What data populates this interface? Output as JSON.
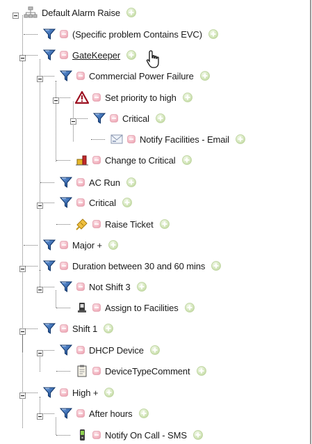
{
  "tree": {
    "root": {
      "label": "Default Alarm Raise",
      "icon": "org-chart-icon"
    },
    "nodes": [
      {
        "label": "(Specific problem Contains EVC)",
        "icon": "filter-icon"
      },
      {
        "label": "GateKeeper",
        "icon": "filter-icon"
      },
      {
        "label": "Commercial Power Failure",
        "icon": "filter-icon"
      },
      {
        "label": "Set priority to high",
        "icon": "warning-icon"
      },
      {
        "label": "Critical",
        "icon": "filter-icon"
      },
      {
        "label": "Notify Facilities - Email",
        "icon": "email-icon"
      },
      {
        "label": "Change to Critical",
        "icon": "severity-change-icon"
      },
      {
        "label": "AC Run",
        "icon": "filter-icon"
      },
      {
        "label": "Critical",
        "icon": "filter-icon"
      },
      {
        "label": "Raise Ticket",
        "icon": "ticket-icon"
      },
      {
        "label": "Major +",
        "icon": "filter-icon"
      },
      {
        "label": "Duration between 30 and 60 mins",
        "icon": "filter-icon"
      },
      {
        "label": "Not Shift 3",
        "icon": "filter-icon"
      },
      {
        "label": "Assign to Facilities",
        "icon": "assign-icon"
      },
      {
        "label": "Shift 1",
        "icon": "filter-icon"
      },
      {
        "label": "DHCP Device",
        "icon": "filter-icon"
      },
      {
        "label": "DeviceTypeComment",
        "icon": "clipboard-icon"
      },
      {
        "label": "High +",
        "icon": "filter-icon"
      },
      {
        "label": "After hours",
        "icon": "filter-icon"
      },
      {
        "label": "Notify On Call - SMS",
        "icon": "sms-phone-icon"
      }
    ]
  },
  "colors": {
    "filter_funnel": "#1d4f96",
    "link_hover": "#1a1a1a",
    "tree_lines": "#707070",
    "disable_bullet": "#f1b8c2",
    "add_bullet": "#cfe3b4"
  }
}
